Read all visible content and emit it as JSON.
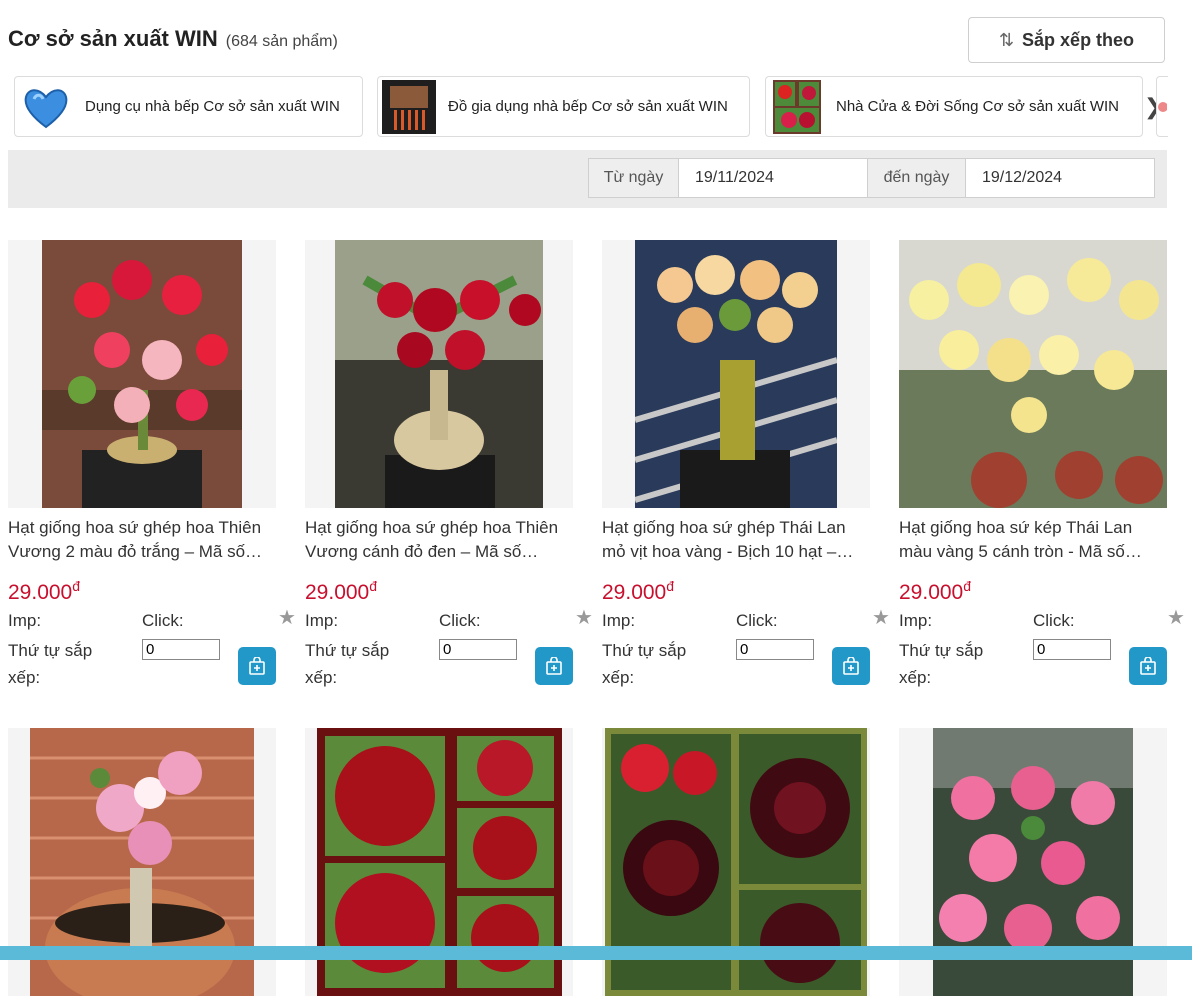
{
  "shop": {
    "title": "Cơ sở sản xuất WIN",
    "count": "(684 sản phẩm)"
  },
  "sort": {
    "label": "Sắp xếp theo",
    "icon": "sort-arrows-icon"
  },
  "categories": [
    {
      "label": "Dụng cụ nhà bếp Cơ sở sản xuất WIN",
      "icon": "blue-heart-mold"
    },
    {
      "label": "Đồ gia dụng nhà bếp Cơ sở sản xuất WIN",
      "icon": "kitchen-knife-set"
    },
    {
      "label": "Nhà Cửa & Đời Sống Cơ sở sản xuất WIN",
      "icon": "flower-collage"
    }
  ],
  "date_filter": {
    "from_label": "Từ ngày",
    "from_value": "19/11/2024",
    "to_label": "đến ngày",
    "to_value": "19/12/2024"
  },
  "product_labels": {
    "imp": "Imp:",
    "click": "Click:",
    "order": "Thứ tự sắp xếp:",
    "order_value": "0"
  },
  "products": [
    {
      "name": "Hạt giống hoa sứ ghép hoa Thiên Vương 2 màu đỏ trắng – Mã số…",
      "price": "29.000",
      "currency": "đ",
      "image": "red and white adenium flowers"
    },
    {
      "name": "Hạt giống hoa sứ ghép hoa Thiên Vương cánh đỏ đen – Mã số…",
      "price": "29.000",
      "currency": "đ",
      "image": "dark red adenium flowers"
    },
    {
      "name": "Hạt giống hoa sứ ghép Thái Lan mỏ vịt hoa vàng - Bịch 10 hạt –…",
      "price": "29.000",
      "currency": "đ",
      "image": "peach yellow adenium flowers"
    },
    {
      "name": "Hạt giống hoa sứ kép Thái Lan màu vàng 5 cánh tròn - Mã số…",
      "price": "29.000",
      "currency": "đ",
      "image": "yellow adenium flowers in greenhouse"
    },
    {
      "name": "",
      "price": "",
      "currency": "",
      "image": "pink white adenium flower"
    },
    {
      "name": "",
      "price": "",
      "currency": "",
      "image": "dark red double adenium collage"
    },
    {
      "name": "",
      "price": "",
      "currency": "",
      "image": "red black adenium collage"
    },
    {
      "name": "",
      "price": "",
      "currency": "",
      "image": "pink double adenium flowers"
    }
  ],
  "colors": {
    "price": "#c8102e",
    "cart_button": "#2198c8",
    "filter_bar": "#ebebeb",
    "bottom_bar": "#5bbad8"
  }
}
